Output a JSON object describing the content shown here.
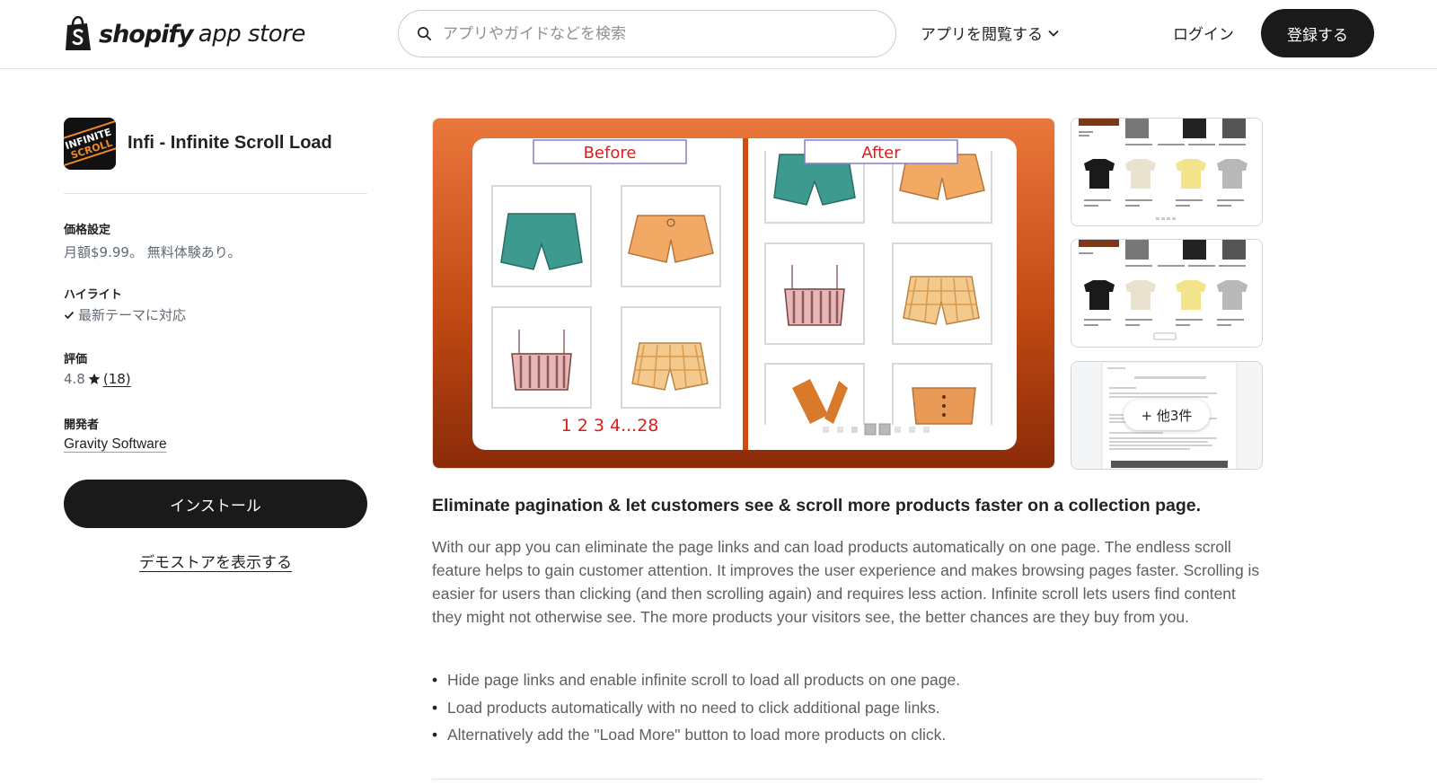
{
  "header": {
    "brand": "shopify",
    "brand_suffix": "app store",
    "search_placeholder": "アプリやガイドなどを検索",
    "browse_label": "アプリを閲覧する",
    "login_label": "ログイン",
    "signup_label": "登録する"
  },
  "sidebar": {
    "app_name": "Infi - Infinite Scroll Load",
    "app_icon_text": [
      "INFINITE",
      "SCROLL"
    ],
    "pricing_label": "価格設定",
    "pricing_value": "月額$9.99。 無料体験あり。",
    "highlights_label": "ハイライト",
    "highlight_item": "最新テーマに対応",
    "rating_label": "評価",
    "rating_value": "4.8",
    "rating_count": "(18)",
    "developer_label": "開発者",
    "developer_name": "Gravity Software",
    "install_label": "インストール",
    "demo_label": "デモストアを表示する"
  },
  "gallery": {
    "before_label": "Before",
    "after_label": "After",
    "pagination_text": "1 2 3 4...28",
    "more_label": "+ 他3件"
  },
  "content": {
    "headline": "Eliminate pagination & let customers see & scroll more products faster on a collection page.",
    "description": "With our app you can eliminate the page links and can load products automatically on one page. The endless scroll feature helps to gain customer attention. It improves the user experience and makes browsing pages faster. Scrolling is easier for users than clicking (and then scrolling again) and requires less action. Infinite scroll lets users find content they might not otherwise see. The more products your visitors see, the better chances are they buy from you.",
    "bullets": [
      "Hide page links and enable infinite scroll to load all products on one page.",
      "Load products automatically with no need to click additional page links.",
      "Alternatively add the \"Load More\" button to load more products on click."
    ]
  },
  "colors": {
    "primary_button": "#1a1a1a",
    "hero_gradient_top": "#e8743a",
    "hero_gradient_bottom": "#8a2a08",
    "before_after_text": "#e11b1b"
  }
}
